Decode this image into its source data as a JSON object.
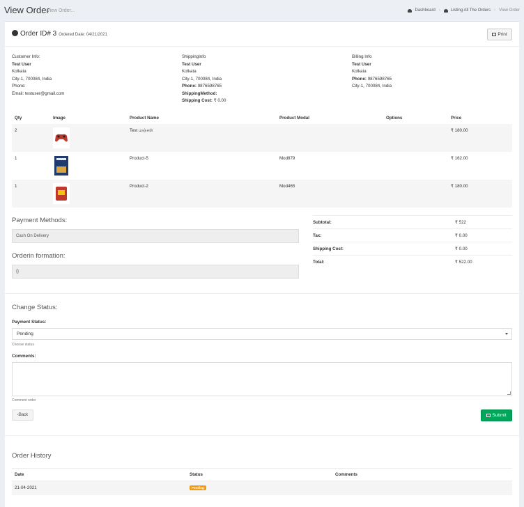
{
  "header": {
    "title": "View Order",
    "subtitle": "View Order..."
  },
  "breadcrumb": {
    "items": [
      "Dashboard",
      "Listing All The Orders",
      "View Order"
    ]
  },
  "order": {
    "id_label": "Order ID# 3",
    "date_label": "Ordered Date: 04/21/2021",
    "print_label": "Print"
  },
  "customer": {
    "heading": "Customer Info:",
    "name": "Test User",
    "city": "Kolkata",
    "address": "City-1, 700084, India",
    "phone_label": "Phone:",
    "email_label": "Email:",
    "email": "testuser@gmail.com"
  },
  "shipping": {
    "heading": "ShippingInfo",
    "name": "Test User",
    "city": "Kolkata",
    "address": "City-1, 700084, India",
    "phone_label": "Phone:",
    "phone": "9876598765",
    "method_label": "ShippingMethod:",
    "cost_label": "Shipping Cost:",
    "cost": "₹ 0.00"
  },
  "billing": {
    "heading": "Billing Info",
    "name": "Test User",
    "city": "Kolkata",
    "phone_label": "Phone:",
    "phone": "9876598765",
    "address": "City-1, 700084, India"
  },
  "products": {
    "columns": [
      "Qty",
      "Image",
      "Product Name",
      "Product Modal",
      "Options",
      "Price"
    ],
    "rows": [
      {
        "qty": "2",
        "image": "gamepad-image",
        "name": "Test மஞ்சள்",
        "model": "",
        "options": "",
        "price": "₹ 180.00"
      },
      {
        "qty": "1",
        "image": "book-image",
        "name": "Product-5",
        "model": "Mod879",
        "options": "",
        "price": "₹ 162.00"
      },
      {
        "qty": "1",
        "image": "package-image",
        "name": "Product-2",
        "model": "Mod465",
        "options": "",
        "price": "₹ 180.00"
      }
    ]
  },
  "payment": {
    "label": "Payment Methods:",
    "value": "Cash On Delivery"
  },
  "order_info": {
    "label": "Orderin formation:",
    "value": "{}"
  },
  "totals": [
    {
      "label": "Subtotal:",
      "value": "₹ 522"
    },
    {
      "label": "Tax:",
      "value": "₹ 0.00"
    },
    {
      "label": "Shipping Cost:",
      "value": "₹ 0.00"
    },
    {
      "label": "Total:",
      "value": "₹ 522.00"
    }
  ],
  "change_status": {
    "heading": "Change Status:",
    "payment_status_label": "Payment Status:",
    "payment_status_value": "Pending",
    "status_help": "Choose status",
    "comments_label": "Comments:",
    "comments_help": "Comment order",
    "back_label": "Back",
    "submit_label": "Submit"
  },
  "history": {
    "heading": "Order History",
    "columns": [
      "Date",
      "Status",
      "Comments"
    ],
    "rows": [
      {
        "date": "21-04-2021",
        "status": "Pending",
        "comments": ""
      }
    ]
  },
  "colors": {
    "submit": "#00a65a",
    "badge": "#f39c12",
    "background": "#ecf0f5"
  }
}
